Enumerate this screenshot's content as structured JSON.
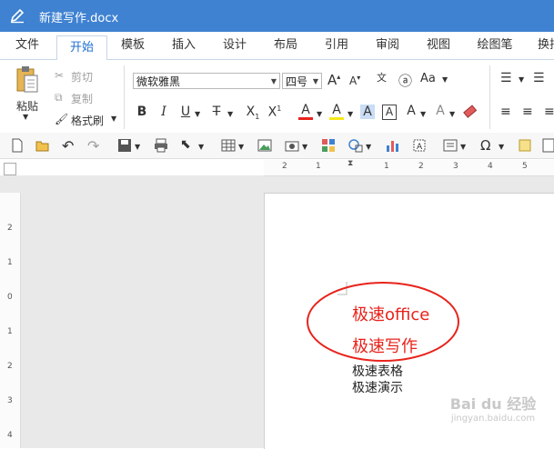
{
  "window": {
    "title": "新建写作.docx"
  },
  "tabs": [
    "文件",
    "开始",
    "模板",
    "插入",
    "设计",
    "布局",
    "引用",
    "审阅",
    "视图",
    "绘图笔",
    "换排"
  ],
  "active_tab": "开始",
  "clipboard": {
    "paste": "粘贴",
    "cut": "剪切",
    "copy": "复制",
    "format_painter": "格式刷"
  },
  "font": {
    "name": "微软雅黑",
    "size": "四号"
  },
  "document": {
    "red_lines": [
      "极速office",
      "极速写作"
    ],
    "lines": [
      "极速表格",
      "极速演示"
    ]
  },
  "ruler": {
    "top_left": [
      "2",
      "1"
    ],
    "top_right": [
      "1",
      "2",
      "3",
      "4",
      "5"
    ],
    "left": [
      "2",
      "1",
      "0",
      "1",
      "2",
      "3",
      "4"
    ]
  },
  "watermark": {
    "text": "Bai du 经验",
    "url": "jingyan.baidu.com"
  },
  "colors": {
    "titlebar": "#3f82d1",
    "accent": "#1e6fd0",
    "red": "#e8231b"
  }
}
